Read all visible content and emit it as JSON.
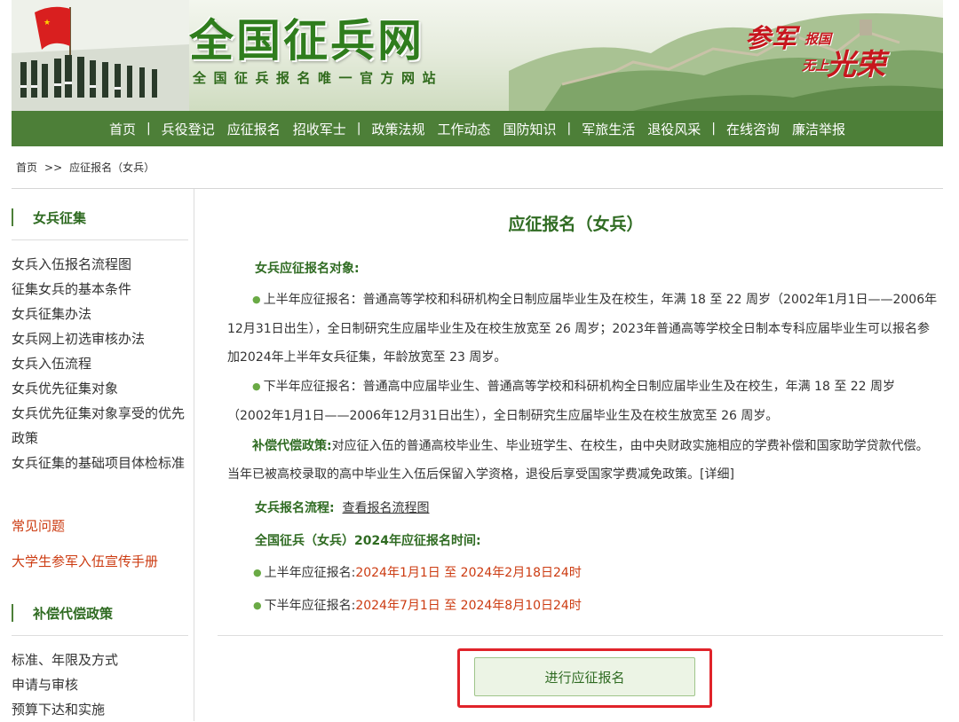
{
  "header": {
    "site_title": "全国征兵网",
    "site_subtitle": "全国征兵报名唯一官方网站",
    "slogan": [
      "参军",
      "报国",
      "无上",
      "光荣"
    ]
  },
  "nav": {
    "items": [
      "首页",
      "兵役登记",
      "应征报名",
      "招收军士",
      "政策法规",
      "工作动态",
      "国防知识",
      "军旅生活",
      "退役风采",
      "在线咨询",
      "廉洁举报"
    ],
    "separator": "|"
  },
  "breadcrumb": {
    "home": "首页",
    "separator": ">>",
    "current": "应征报名（女兵）"
  },
  "sidebar": {
    "section1_title": "女兵征集",
    "section1_links": [
      "女兵入伍报名流程图",
      "征集女兵的基本条件",
      "女兵征集办法",
      "女兵网上初选审核办法",
      "女兵入伍流程",
      "女兵优先征集对象",
      "女兵优先征集对象享受的优先政策",
      "女兵征集的基础项目体检标准"
    ],
    "faq": "常见问题",
    "handbook": "大学生参军入伍宣传手册",
    "section2_title": "补偿代偿政策",
    "section2_links": [
      "标准、年限及方式",
      "申请与审核",
      "预算下达和实施"
    ]
  },
  "main": {
    "title": "应征报名（女兵）",
    "target_label": "女兵应征报名对象:",
    "bullet": "●",
    "first_half_label": "上半年应征报名",
    "first_half_text": "普通高等学校和科研机构全日制应届毕业生及在校生，年满 18 至 22 周岁（2002年1月1日——2006年12月31日出生），全日制研究生应届毕业生及在校生放宽至 26 周岁；2023年普通高等学校全日制本专科应届毕业生可以报名参加2024年上半年女兵征集，年龄放宽至 23 周岁。",
    "second_half_label": "下半年应征报名",
    "second_half_text": "普通高中应届毕业生、普通高等学校和科研机构全日制应届毕业生及在校生，年满 18 至 22 周岁（2002年1月1日——2006年12月31日出生），全日制研究生应届毕业生及在校生放宽至 26 周岁。",
    "compensation_label": "补偿代偿政策:",
    "compensation_text": "对应征入伍的普通高校毕业生、毕业班学生、在校生，由中央财政实施相应的学费补偿和国家助学贷款代偿。当年已被高校录取的高中毕业生入伍后保留入学资格，退役后享受国家学费减免政策。",
    "detail_link": "[详细]",
    "process_label": "女兵报名流程:",
    "process_link": "查看报名流程图",
    "time_title": "全国征兵（女兵）2024年应征报名时间:",
    "first_half_time_label": "上半年应征报名:",
    "first_half_time": "2024年1月1日 至 2024年2月18日24时",
    "second_half_time_label": "下半年应征报名:",
    "second_half_time": "2024年7月1日 至 2024年8月10日24时",
    "register_button": "进行应征报名"
  },
  "colors": {
    "nav_bg": "#4d7f38",
    "title_green": "#2f6b22",
    "highlight_red": "#cc3b11",
    "frame_red": "#e0232a"
  }
}
